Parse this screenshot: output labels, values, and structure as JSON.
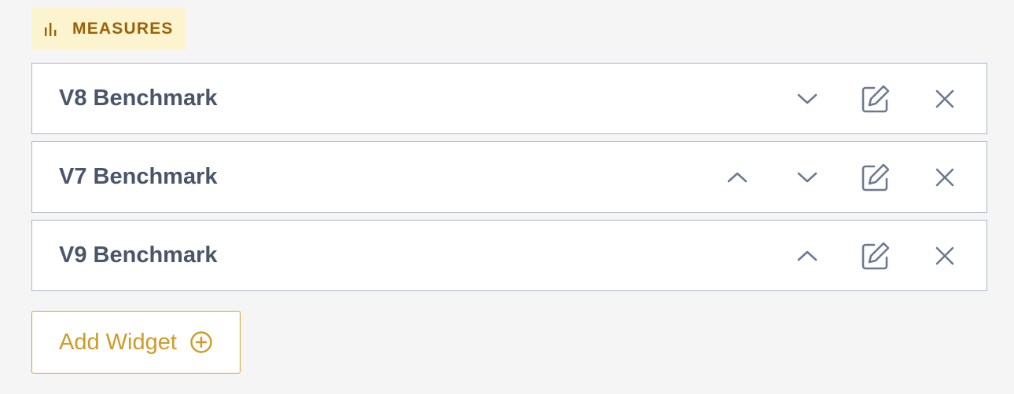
{
  "section": {
    "label": "MEASURES",
    "icon": "bar-chart-icon"
  },
  "widgets": [
    {
      "title": "V8 Benchmark",
      "controls": [
        "chevron-down-icon",
        "edit-icon",
        "close-icon"
      ]
    },
    {
      "title": "V7 Benchmark",
      "controls": [
        "chevron-up-icon",
        "chevron-down-icon",
        "edit-icon",
        "close-icon"
      ]
    },
    {
      "title": "V9 Benchmark",
      "controls": [
        "chevron-up-icon",
        "edit-icon",
        "close-icon"
      ]
    }
  ],
  "add_widget": {
    "label": "Add Widget",
    "icon": "plus-circle-icon"
  },
  "colors": {
    "badge_bg": "#fcf3cf",
    "badge_text": "#9a6207",
    "row_border": "#a9b4c8",
    "title_text": "#4a5568",
    "icon": "#6b7a90",
    "accent": "#d09a26"
  }
}
